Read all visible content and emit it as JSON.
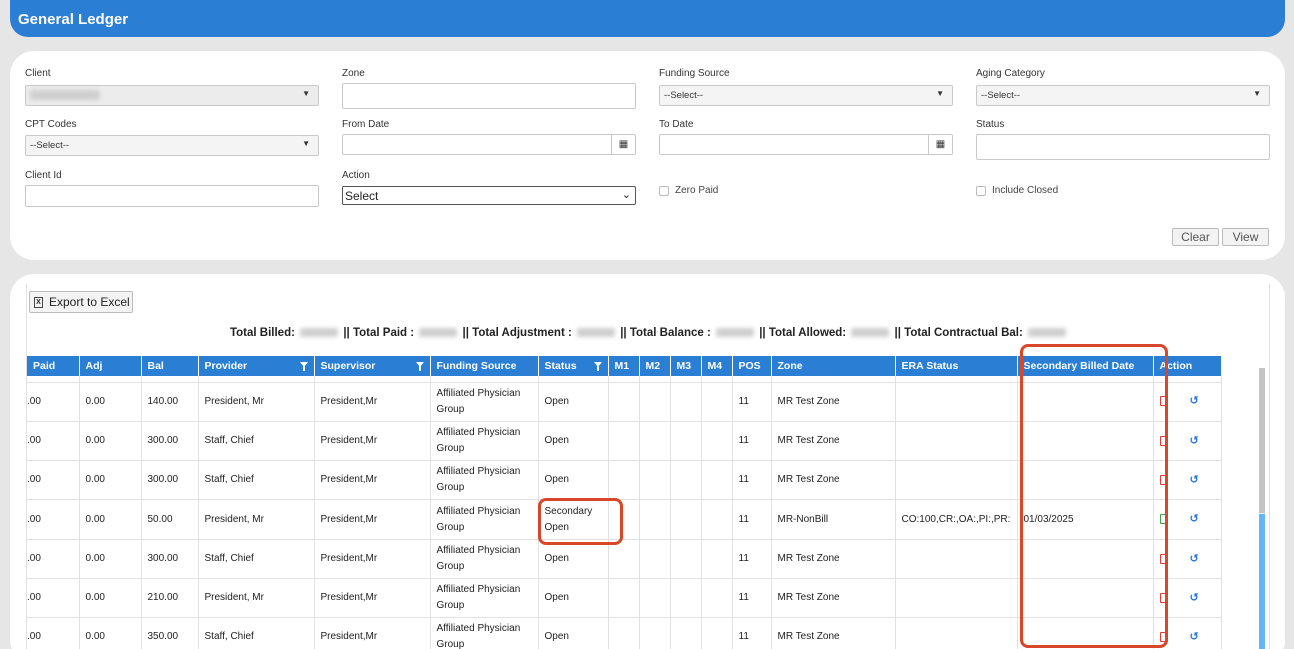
{
  "header": {
    "title": "General Ledger"
  },
  "filters": {
    "client": {
      "label": "Client"
    },
    "zone": {
      "label": "Zone",
      "value": ""
    },
    "funding_source": {
      "label": "Funding Source",
      "value": "--Select--"
    },
    "aging_category": {
      "label": "Aging Category",
      "value": "--Select--"
    },
    "cpt_codes": {
      "label": "CPT Codes",
      "value": "--Select--"
    },
    "from_date": {
      "label": "From Date",
      "value": ""
    },
    "to_date": {
      "label": "To Date",
      "value": ""
    },
    "status": {
      "label": "Status",
      "value": ""
    },
    "client_id": {
      "label": "Client Id",
      "value": ""
    },
    "action": {
      "label": "Action",
      "value": "Select"
    },
    "zero_paid": {
      "label": "Zero Paid"
    },
    "include_closed": {
      "label": "Include Closed"
    },
    "clear_label": "Clear",
    "view_label": "View"
  },
  "results": {
    "export_label": "Export to Excel",
    "totals": {
      "billed": "Total Billed:",
      "paid": "|| Total Paid :",
      "adjustment": "|| Total Adjustment :",
      "balance": "|| Total Balance :",
      "allowed": "|| Total Allowed:",
      "contractual": "|| Total Contractual Bal:"
    },
    "columns": [
      "Paid",
      "Adj",
      "Bal",
      "Provider",
      "Supervisor",
      "Funding Source",
      "Status",
      "M1",
      "M2",
      "M3",
      "M4",
      "POS",
      "Zone",
      "ERA Status",
      "Secondary Billed Date",
      "Action"
    ],
    "rows": [
      {
        "paid": ".00",
        "adj": "0.00",
        "bal": "140.00",
        "provider": "President, Mr",
        "supervisor": "President,Mr",
        "funding": "Affiliated Physician Group",
        "status": "Open",
        "pos": "11",
        "zone": "MR Test Zone",
        "era": "",
        "sec_date": "",
        "pdf": "red"
      },
      {
        "paid": ".00",
        "adj": "0.00",
        "bal": "300.00",
        "provider": "Staff, Chief",
        "supervisor": "President,Mr",
        "funding": "Affiliated Physician Group",
        "status": "Open",
        "pos": "11",
        "zone": "MR Test Zone",
        "era": "",
        "sec_date": "",
        "pdf": "red"
      },
      {
        "paid": ".00",
        "adj": "0.00",
        "bal": "300.00",
        "provider": "Staff, Chief",
        "supervisor": "President,Mr",
        "funding": "Affiliated Physician Group",
        "status": "Open",
        "pos": "11",
        "zone": "MR Test Zone",
        "era": "",
        "sec_date": "",
        "pdf": "red"
      },
      {
        "paid": ".00",
        "adj": "0.00",
        "bal": "50.00",
        "provider": "President, Mr",
        "supervisor": "President,Mr",
        "funding": "Affiliated Physician Group",
        "status": "Secondary Open",
        "pos": "11",
        "zone": "MR-NonBill",
        "era": "CO:100,CR:,OA:,PI:,PR:",
        "sec_date": "01/03/2025",
        "pdf": "green"
      },
      {
        "paid": ".00",
        "adj": "0.00",
        "bal": "300.00",
        "provider": "Staff, Chief",
        "supervisor": "President,Mr",
        "funding": "Affiliated Physician Group",
        "status": "Open",
        "pos": "11",
        "zone": "MR Test Zone",
        "era": "",
        "sec_date": "",
        "pdf": "red"
      },
      {
        "paid": ".00",
        "adj": "0.00",
        "bal": "210.00",
        "provider": "President, Mr",
        "supervisor": "President,Mr",
        "funding": "Affiliated Physician Group",
        "status": "Open",
        "pos": "11",
        "zone": "MR Test Zone",
        "era": "",
        "sec_date": "",
        "pdf": "red"
      },
      {
        "paid": ".00",
        "adj": "0.00",
        "bal": "350.00",
        "provider": "Staff, Chief",
        "supervisor": "President,Mr",
        "funding": "Affiliated Physician Group",
        "status": "Open",
        "pos": "11",
        "zone": "MR Test Zone",
        "era": "",
        "sec_date": "",
        "pdf": "red"
      }
    ]
  },
  "colors": {
    "accent": "#2a7fd4",
    "highlight": "#d9472b"
  }
}
